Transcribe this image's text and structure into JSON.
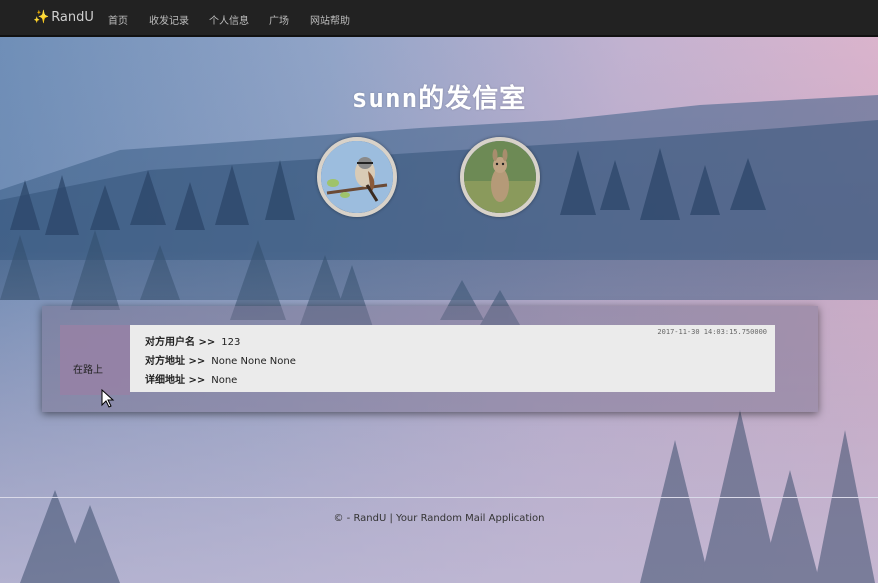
{
  "navbar": {
    "brand": "RandU",
    "items": [
      "首页",
      "收发记录",
      "个人信息",
      "广场",
      "网站帮助"
    ]
  },
  "page_title": "sunn的发信室",
  "avatars": {
    "left": "bird-avatar",
    "right": "kangaroo-avatar"
  },
  "message": {
    "status_label": "在路上",
    "timestamp": "2017-11-30 14:03:15.750000",
    "recipient_label": "对方用户名 >>",
    "recipient_value": "123",
    "address_label": "对方地址 >>",
    "address_value": "None None None",
    "detail_label": "详细地址 >>",
    "detail_value": "None"
  },
  "footer": "© - RandU | Your Random Mail Application",
  "colors": {
    "navbar_bg": "#222222",
    "status_bg": "#9682a5",
    "card_bg": "#ebebeb"
  }
}
